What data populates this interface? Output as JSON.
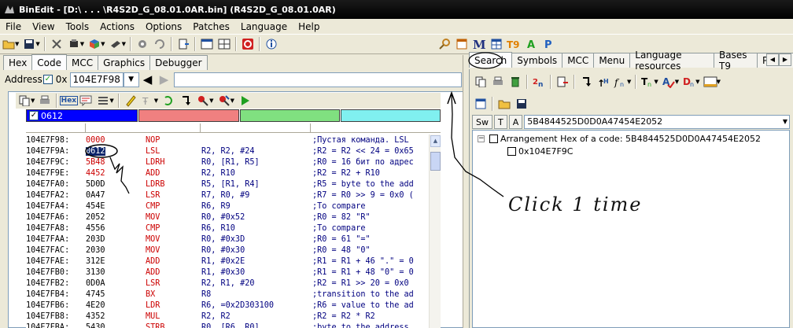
{
  "window": {
    "title": "BinEdit - [D:\\ . . . \\R4S2D_G_08.01.0AR.bin] (R4S2D_G_08.01.0AR)"
  },
  "menu": [
    "File",
    "View",
    "Tools",
    "Actions",
    "Options",
    "Patches",
    "Language",
    "Help"
  ],
  "left_tabs": [
    "Hex",
    "Code",
    "MCC",
    "Graphics",
    "Debugger"
  ],
  "address_bar": {
    "label": "Address",
    "prefix": "0x",
    "value": "104E7F98"
  },
  "search_row_value": "0612",
  "hex_tb_label": "Hex",
  "color_bar": {
    "colors": [
      "#0000ff",
      "#f08080",
      "#80e080",
      "#80f0f0"
    ]
  },
  "listing": [
    {
      "addr": "104E7F98:",
      "hex": "0000",
      "op": "NOP",
      "args": "",
      "cmt": ";Пустая команда. LSL"
    },
    {
      "addr": "104E7F9A:",
      "hex": "0612",
      "op": "LSL",
      "args": "R2, R2, #24",
      "cmt": ";R2 = R2 << 24 = 0x65"
    },
    {
      "addr": "104E7F9C:",
      "hex": "5B48",
      "op": "LDRH",
      "args": "R0, [R1, R5]",
      "cmt": ";R0 = 16 бит по адрес"
    },
    {
      "addr": "104E7F9E:",
      "hex": "4452",
      "op": "ADD",
      "args": "R2, R10",
      "cmt": ";R2 = R2 + R10"
    },
    {
      "addr": "104E7FA0:",
      "hex": "5D0D",
      "op": "LDRB",
      "args": "R5, [R1, R4]",
      "cmt": ";R5 = byte to the add"
    },
    {
      "addr": "104E7FA2:",
      "hex": "0A47",
      "op": "LSR",
      "args": "R7, R0, #9",
      "cmt": ";R7 = R0 >> 9 = 0x0 ("
    },
    {
      "addr": "104E7FA4:",
      "hex": "454E",
      "op": "CMP",
      "args": "R6, R9",
      "cmt": ";To compare"
    },
    {
      "addr": "104E7FA6:",
      "hex": "2052",
      "op": "MOV",
      "args": "R0, #0x52",
      "cmt": ";R0 = 82 \"R\""
    },
    {
      "addr": "104E7FA8:",
      "hex": "4556",
      "op": "CMP",
      "args": "R6, R10",
      "cmt": ";To compare"
    },
    {
      "addr": "104E7FAA:",
      "hex": "203D",
      "op": "MOV",
      "args": "R0, #0x3D",
      "cmt": ";R0 = 61 \"=\""
    },
    {
      "addr": "104E7FAC:",
      "hex": "2030",
      "op": "MOV",
      "args": "R0, #0x30",
      "cmt": ";R0 = 48 \"0\""
    },
    {
      "addr": "104E7FAE:",
      "hex": "312E",
      "op": "ADD",
      "args": "R1, #0x2E",
      "cmt": ";R1 = R1 + 46 \".\" = 0"
    },
    {
      "addr": "104E7FB0:",
      "hex": "3130",
      "op": "ADD",
      "args": "R1, #0x30",
      "cmt": ";R1 = R1 + 48 \"0\" = 0"
    },
    {
      "addr": "104E7FB2:",
      "hex": "0D0A",
      "op": "LSR",
      "args": "R2, R1, #20",
      "cmt": ";R2 = R1 >> 20 = 0x0"
    },
    {
      "addr": "104E7FB4:",
      "hex": "4745",
      "op": "BX",
      "args": "R8",
      "cmt": ";transition to the ad"
    },
    {
      "addr": "104E7FB6:",
      "hex": "4E20",
      "op": "LDR",
      "args": "R6, =0x2D303100",
      "cmt": ";R6 = value to the ad"
    },
    {
      "addr": "104E7FB8:",
      "hex": "4352",
      "op": "MUL",
      "args": "R2, R2",
      "cmt": ";R2 = R2 * R2"
    },
    {
      "addr": "104E7FBA:",
      "hex": "5430",
      "op": "STRB",
      "args": "R0, [R6, R0]",
      "cmt": ";byte to the address"
    }
  ],
  "right_tabs": [
    "Search",
    "Symbols",
    "MCC",
    "Menu",
    "Language resources",
    "Bases T9",
    "Proce"
  ],
  "search": {
    "btn_sw": "Sw",
    "btn_t": "T",
    "btn_a": "A",
    "query": "5B4844525D0D0A47454E2052"
  },
  "tree": {
    "root": "Arrangement Hex of a code: 5B4844525D0D0A47454E2052",
    "child": "0x104E7F9C"
  },
  "annotation": {
    "text": "Click 1 time"
  }
}
